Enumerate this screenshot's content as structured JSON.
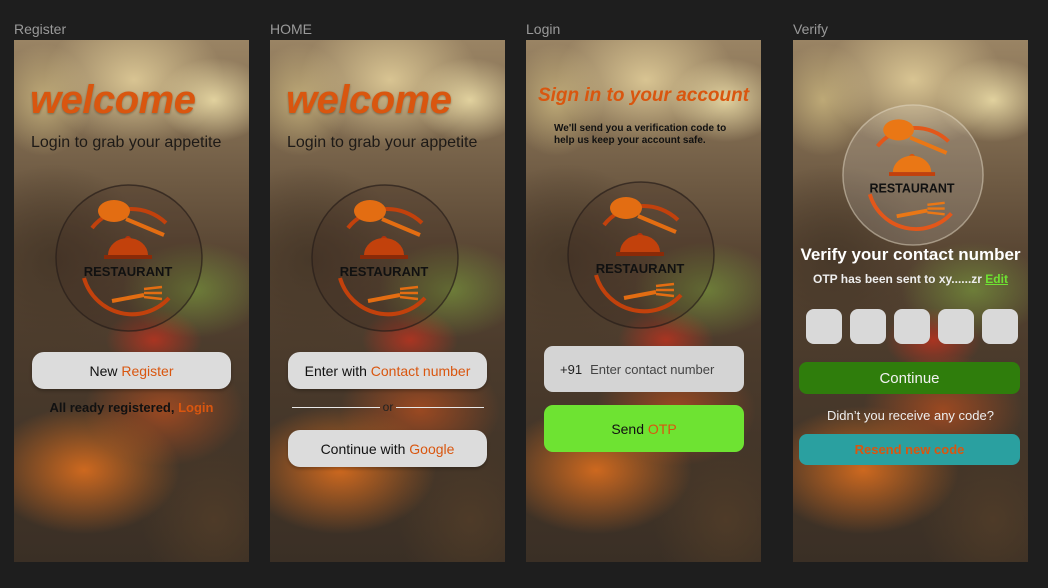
{
  "frames": {
    "register": {
      "label": "Register",
      "welcome": "welcome",
      "subtitle": "Login to grab your appetite",
      "logo_text": "RESTAURANT",
      "button_prefix": "New",
      "button_accent": "Register",
      "login_prefix": "All ready registered,",
      "login_link": "Login"
    },
    "home": {
      "label": "HOME",
      "welcome": "welcome",
      "subtitle": "Login to grab your appetite",
      "logo_text": "RESTAURANT",
      "contact_prefix": "Enter with",
      "contact_accent": "Contact number",
      "or_text": "or",
      "google_prefix": "Continue with",
      "google_accent": "Google"
    },
    "login": {
      "label": "Login",
      "title": "Sign in to your account",
      "description": "We'll send you a verification code to help us keep your account safe.",
      "logo_text": "RESTAURANT",
      "country_code": "+91",
      "phone_placeholder": "Enter contact number",
      "send_prefix": "Send",
      "send_accent": "OTP"
    },
    "verify": {
      "label": "Verify",
      "logo_text": "RESTAURANT",
      "title": "Verify your contact number",
      "otp_sent": "OTP has been sent to xy......zr",
      "edit_link": "Edit",
      "continue_label": "Continue",
      "no_code": "Didn’t you receive any code?",
      "resend_label": "Resend new code"
    }
  },
  "colors": {
    "accent_orange": "#d9560f",
    "send_green": "#6ee332",
    "continue_green": "#2f7d0c",
    "resend_teal": "#2aa0a0"
  }
}
